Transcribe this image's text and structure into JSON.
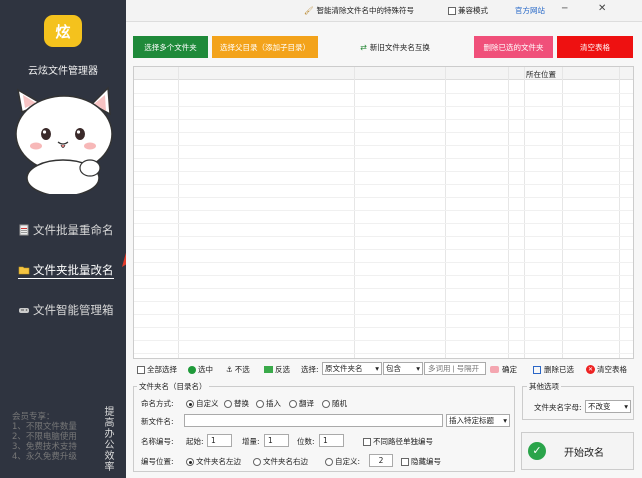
{
  "app": {
    "logo_text": "炫",
    "title": "云炫文件管理器"
  },
  "nav": [
    {
      "label": "文件批量重命名"
    },
    {
      "label": "文件夹批量改名"
    },
    {
      "label": "文件智能管理箱"
    }
  ],
  "footer": {
    "lines": [
      "会员专享：",
      "1、不限文件数量",
      "2、不限电脑使用",
      "3、免费技术支持",
      "4、永久免费升级"
    ],
    "vertical": "提高办公效率"
  },
  "topbar": {
    "clean_label": "智能清除文件名中的特殊符号",
    "compat_label": "兼容模式",
    "site_label": "官方网站"
  },
  "toolbar": {
    "select_folders": "选择多个文件夹",
    "select_dir": "选择父目录（添加子目录）",
    "swap_names": "新旧文件夹名互换",
    "delete_selected": "删除已选的文件夹",
    "clear_table": "清空表格"
  },
  "table": {
    "headers": [
      "",
      "",
      "",
      "",
      "",
      "所在位置",
      ""
    ]
  },
  "actions": {
    "select_all": "全部选择",
    "select": "选中",
    "deselect": "不选",
    "invert": "反选",
    "choose_label": "选择:",
    "field_value": "原文件夹名",
    "mode_value": "包含",
    "filter_placeholder": "多词用 | 号隔开",
    "confirm": "确定",
    "delete_selected": "删除已选",
    "clear": "清空表格"
  },
  "options": {
    "group_title": "文件夹名（目录名）",
    "naming_label": "命名方式:",
    "naming_modes": [
      "自定义",
      "替换",
      "插入",
      "翻译",
      "随机"
    ],
    "newname_label": "新文件名:",
    "newname_value": "",
    "insert_label": "插入特定标题",
    "numbering_label": "名称编号:",
    "start_label": "起始:",
    "start_value": "1",
    "step_label": "增量:",
    "step_value": "1",
    "digits_label": "位数:",
    "digits_value": "1",
    "separate_label": "不同路径单独编号",
    "position_label": "编号位置:",
    "pos_left": "文件夹名左边",
    "pos_right": "文件夹名右边",
    "pos_custom": "自定义:",
    "custom_value": "2",
    "hide_label": "隐藏编号"
  },
  "other": {
    "title": "其他选项",
    "case_label": "文件夹名字母:",
    "case_value": "不改变",
    "start_label": "开始改名"
  }
}
